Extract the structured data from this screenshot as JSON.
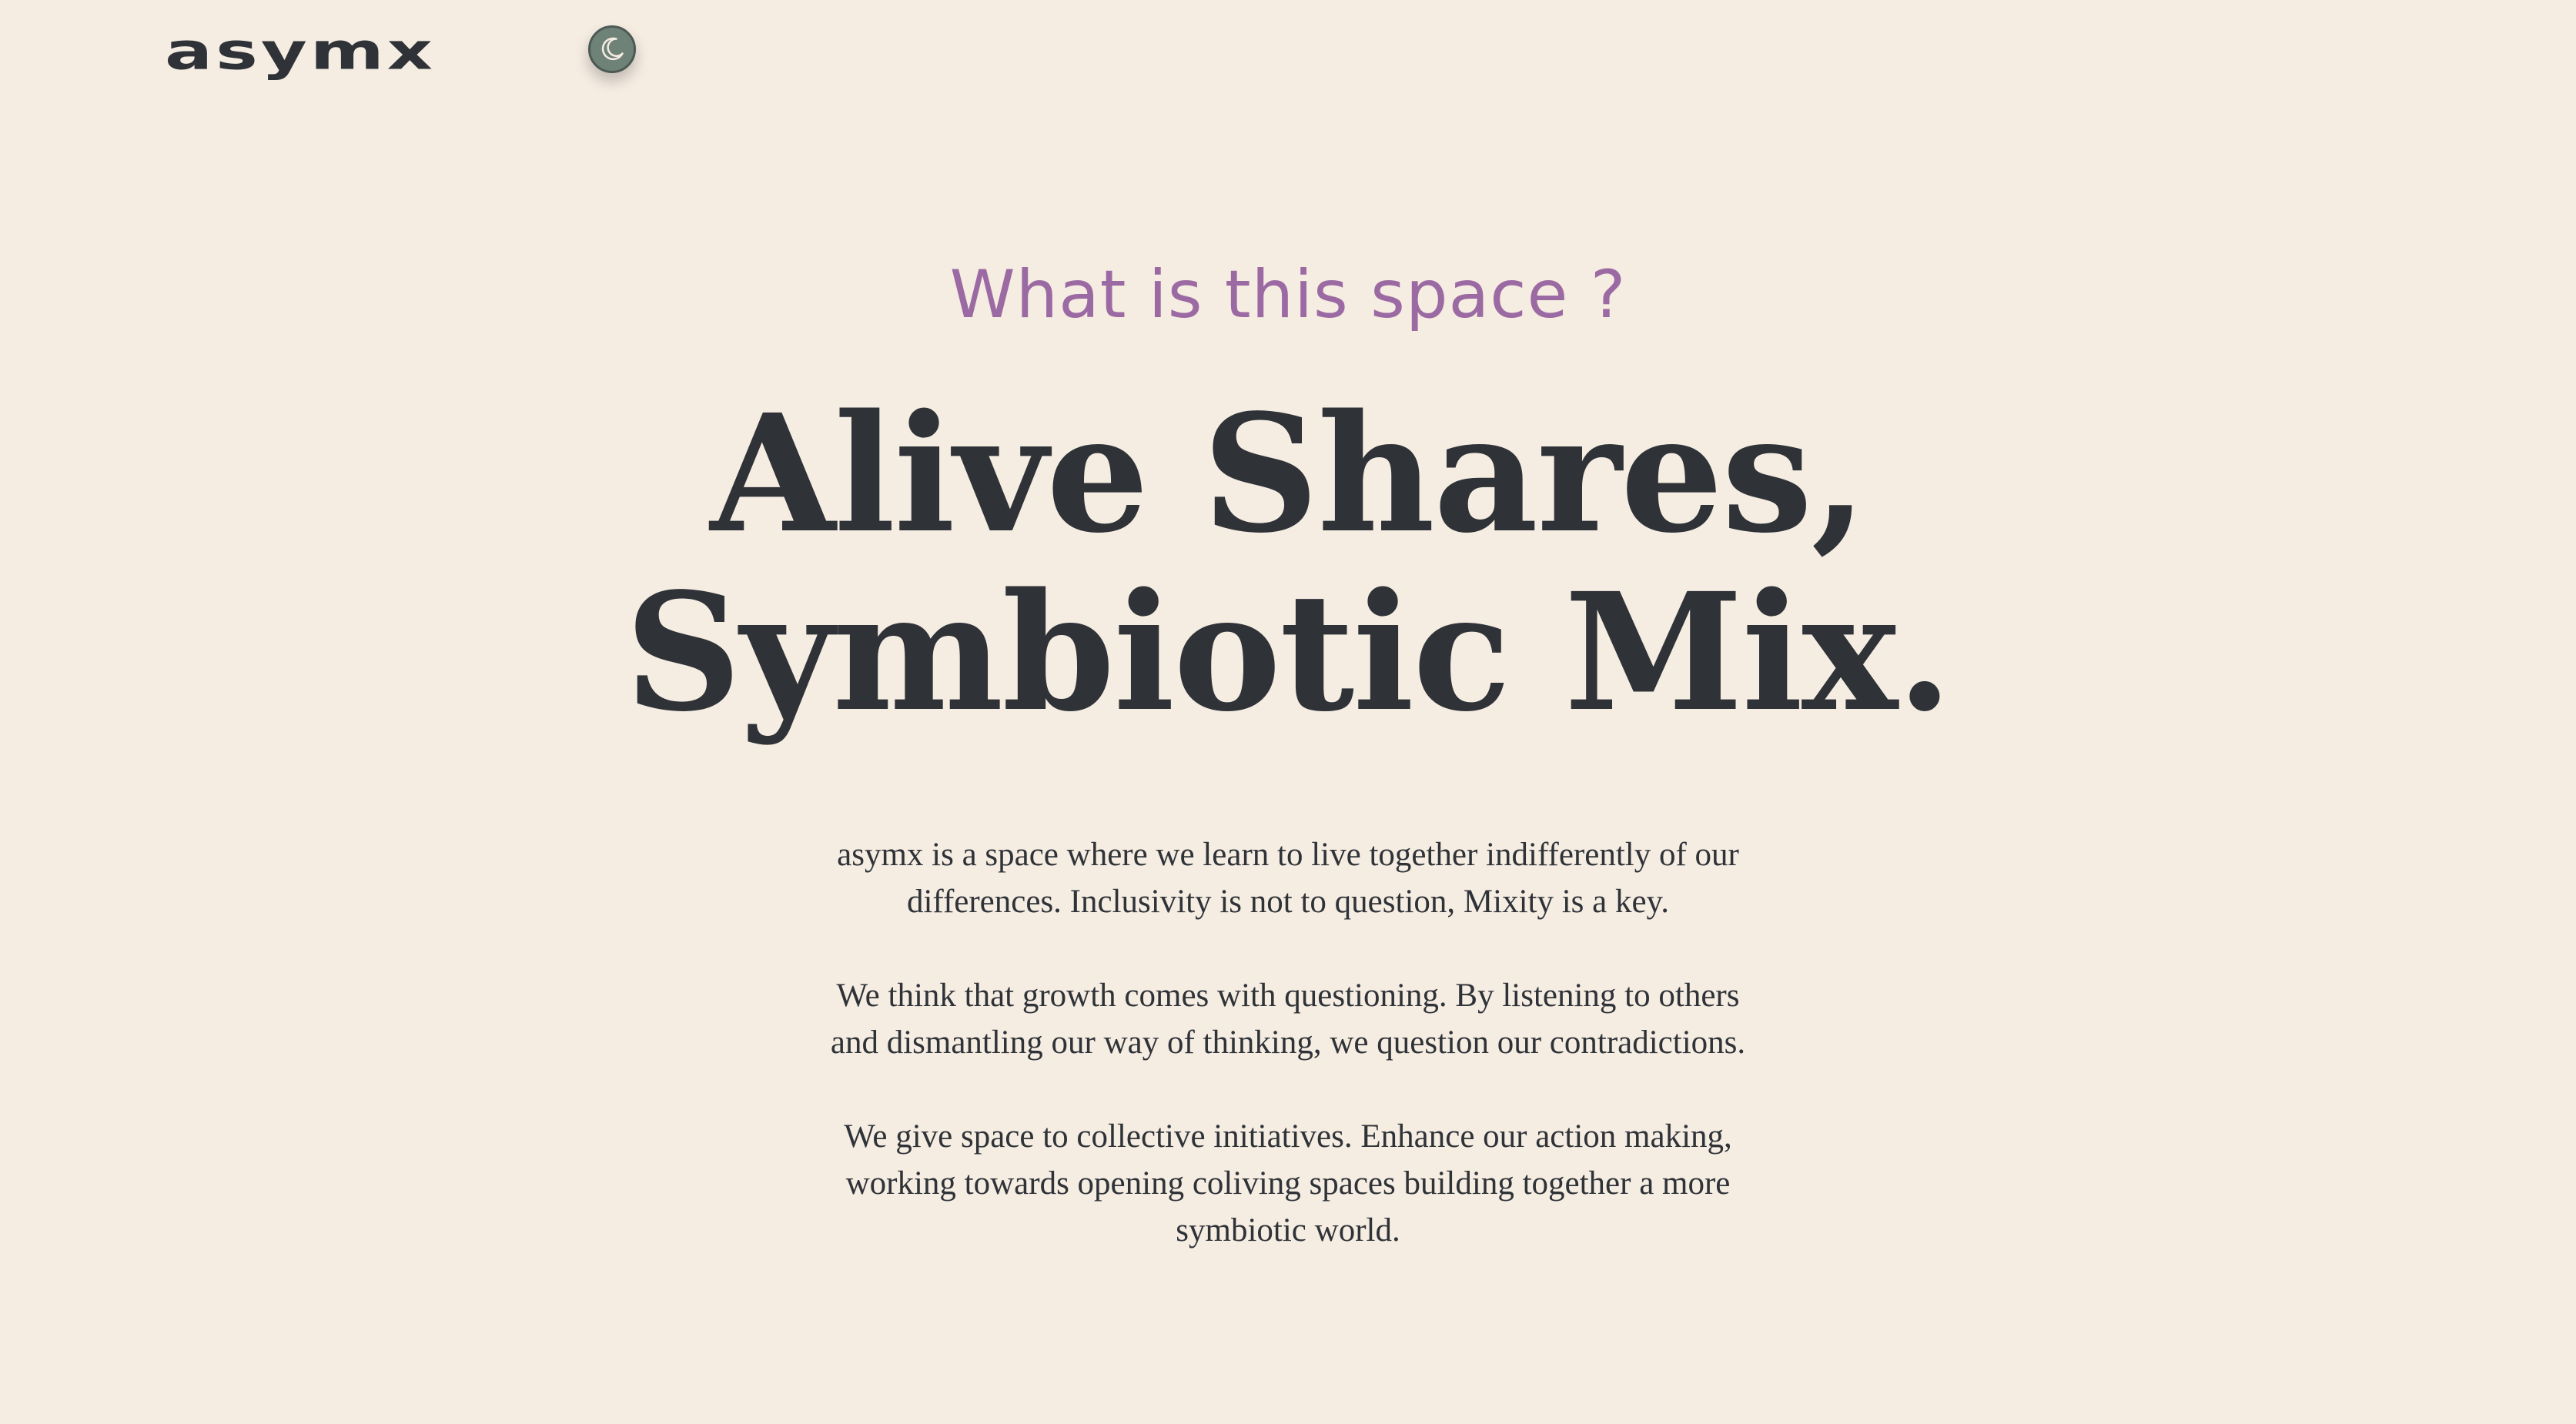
{
  "header": {
    "logo_text": "asymx",
    "theme_toggle_icon": "moon-icon"
  },
  "hero": {
    "eyebrow": "What is this space ?",
    "headline_line_1": "Alive Shares,",
    "headline_line_2": "Symbiotic Mix.",
    "paragraphs": [
      "asymx is a space where we learn to live together indifferently of our differences. Inclusivity is not to question, Mixity is a key.",
      "We think that growth comes with questioning. By listening to others and dismantling our way of thinking, we question our contradictions.",
      "We give space to collective initiatives. Enhance our action making, working towards opening coliving spaces building together a more symbiotic world."
    ]
  },
  "colors": {
    "background": "#f5ece2",
    "text": "#2f3338",
    "accent": "#9b6aa3",
    "toggle": "#6e8278"
  }
}
